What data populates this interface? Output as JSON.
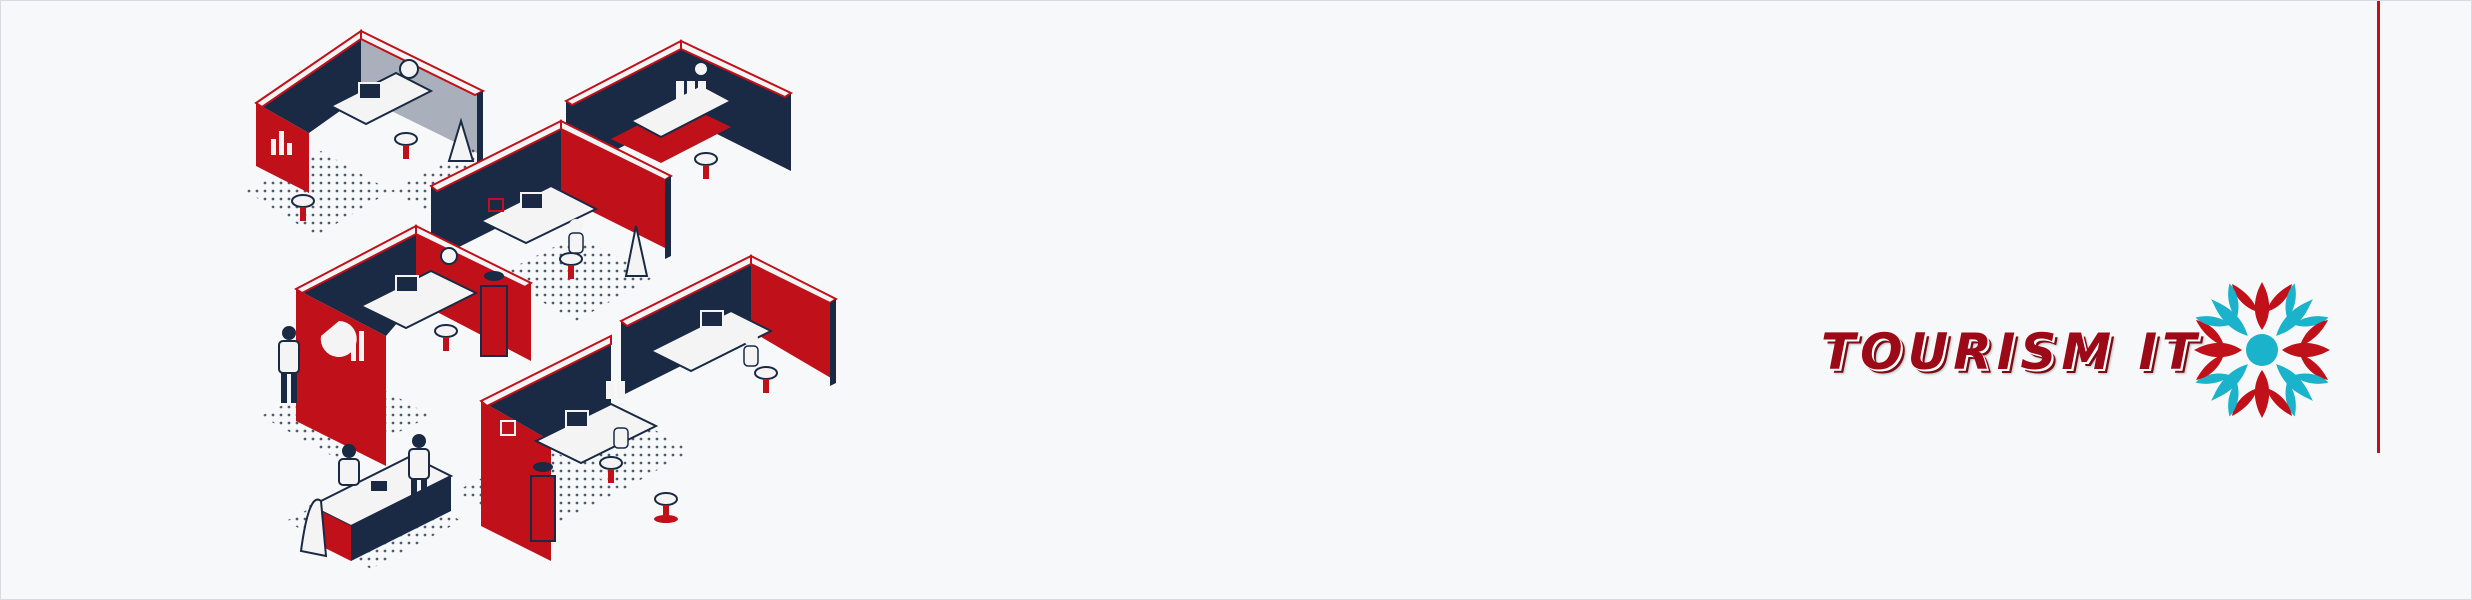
{
  "brand": {
    "name": "TOURISM IT",
    "colors": {
      "primary": "#c0111b",
      "dark": "#1a2a44",
      "accent": "#1bb3cc",
      "background": "#f7f8fa"
    }
  },
  "illustration": {
    "icon": "isometric-office-cubicles-illustration"
  }
}
